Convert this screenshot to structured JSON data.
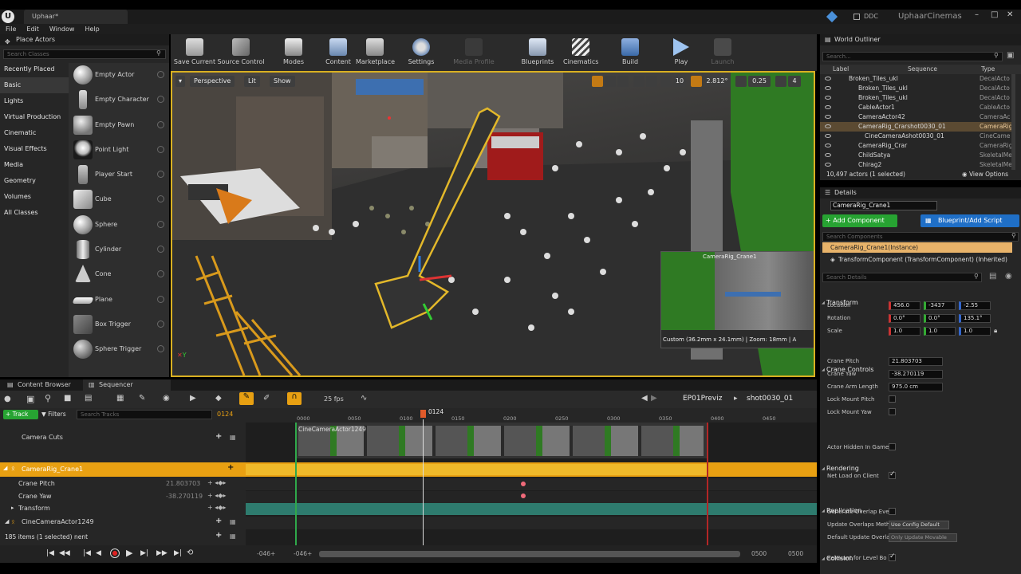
{
  "window": {
    "tab_title": "Uphaar*",
    "project_name": "UphaarCinemas",
    "ddc_label": "DDC"
  },
  "menu": [
    "File",
    "Edit",
    "Window",
    "Help"
  ],
  "place_actors": {
    "title": "Place Actors",
    "search_placeholder": "Search Classes",
    "categories": [
      "Recently Placed",
      "Basic",
      "Lights",
      "Virtual Production",
      "Cinematic",
      "Visual Effects",
      "Media",
      "Geometry",
      "Volumes",
      "All Classes"
    ],
    "selected_category": "Basic",
    "actors": [
      "Empty Actor",
      "Empty Character",
      "Empty Pawn",
      "Point Light",
      "Player Start",
      "Cube",
      "Sphere",
      "Cylinder",
      "Cone",
      "Plane",
      "Box Trigger",
      "Sphere Trigger"
    ]
  },
  "toolbar": {
    "buttons": [
      {
        "label": "Save Current",
        "icon": "save-icon",
        "enabled": true
      },
      {
        "label": "Source Control",
        "icon": "source-control-icon",
        "enabled": true
      },
      {
        "label": "Modes",
        "icon": "modes-icon",
        "enabled": true
      },
      {
        "label": "Content",
        "icon": "content-icon",
        "enabled": true
      },
      {
        "label": "Marketplace",
        "icon": "marketplace-icon",
        "enabled": true
      },
      {
        "label": "Settings",
        "icon": "settings-icon",
        "enabled": true
      },
      {
        "label": "Media Profile",
        "icon": "media-profile-icon",
        "enabled": false
      },
      {
        "label": "Blueprints",
        "icon": "blueprints-icon",
        "enabled": true
      },
      {
        "label": "Cinematics",
        "icon": "cinematics-icon",
        "enabled": true
      },
      {
        "label": "Build",
        "icon": "build-icon",
        "enabled": true
      },
      {
        "label": "Play",
        "icon": "play-icon",
        "enabled": true
      },
      {
        "label": "Launch",
        "icon": "launch-icon",
        "enabled": false
      }
    ]
  },
  "viewport": {
    "perspective": "Perspective",
    "lit": "Lit",
    "show": "Show",
    "grid_snap": "10",
    "rotation_snap": "2.812°",
    "scale_snap": "0.25",
    "camera_speed": "4",
    "pip_title": "CameraRig_Crane1",
    "pip_info": "Custom (36.2mm x 24.1mm) | Zoom: 18mm | A"
  },
  "bottom_tabs": [
    "Content Browser",
    "Sequencer"
  ],
  "sequencer": {
    "fps": "25 fps",
    "add_track": "+ Track",
    "filters": "Filters",
    "search_placeholder": "Search Tracks",
    "current_frame": "0124",
    "breadcrumb_sequence": "EP01Previz",
    "breadcrumb_shot": "shot0030_01",
    "ruler_ticks": [
      "0000",
      "0050",
      "0100",
      "0150",
      "0200",
      "0250",
      "0300",
      "0350",
      "0400",
      "0450"
    ],
    "playhead_label": "0124",
    "camera_cuts_clip": "CineCameraActor1249",
    "tracks": [
      {
        "name": "Camera Cuts",
        "value": ""
      },
      {
        "name": "CameraRig_Crane1",
        "value": ""
      },
      {
        "name": "Crane Pitch",
        "value": "21.803703"
      },
      {
        "name": "Crane Yaw",
        "value": "-38.270119"
      },
      {
        "name": "Transform",
        "value": ""
      },
      {
        "name": "CineCameraActor1249",
        "value": ""
      }
    ],
    "status": "185 items (1 selected)",
    "status_suffix": "nent",
    "range_start_a": "-046+",
    "range_start_b": "-046+",
    "range_end_a": "0500",
    "range_end_b": "0500"
  },
  "world_outliner": {
    "title": "World Outliner",
    "search_placeholder": "Search...",
    "columns": [
      "Label",
      "Sequence",
      "Type"
    ],
    "rows": [
      {
        "label": "Broken_Tiles_ukl",
        "type": "DecalActo"
      },
      {
        "label": "Broken_Tiles_ukl",
        "type": "DecalActo"
      },
      {
        "label": "Broken_Tiles_ukl",
        "type": "DecalActo"
      },
      {
        "label": "CableActor1",
        "type": "CableActo"
      },
      {
        "label": "CameraActor42",
        "type": "CameraAc"
      },
      {
        "label": "CameraRig_Crarshot0030_01",
        "type": "CameraRig",
        "selected": true
      },
      {
        "label": "CineCameraAshot0030_01",
        "type": "CineCame"
      },
      {
        "label": "CameraRig_Crar",
        "type": "CameraRig"
      },
      {
        "label": "ChildSatya",
        "type": "SkeletalMe"
      },
      {
        "label": "Chirag2",
        "type": "SkeletalMe"
      }
    ],
    "footer": "10,497 actors (1 selected)",
    "view_options": "View Options"
  },
  "details": {
    "title": "Details",
    "actor_name": "CameraRig_Crane1",
    "add_component": "+ Add Component",
    "blueprint_script": "Blueprint/Add Script",
    "search_components": "Search Components",
    "instance_row": "CameraRig_Crane1(Instance)",
    "transform_component": "TransformComponent (TransformComponent) (Inherited)",
    "search_details": "Search Details",
    "transform": {
      "header": "Transform",
      "location_label": "Location",
      "location": [
        "456.0",
        "-3437",
        "-2.55"
      ],
      "rotation_label": "Rotation",
      "rotation": [
        "0.0°",
        "0.0°",
        "135.1°"
      ],
      "scale_label": "Scale",
      "scale": [
        "1.0",
        "1.0",
        "1.0"
      ]
    },
    "crane_controls": {
      "header": "Crane Controls",
      "pitch_label": "Crane Pitch",
      "pitch": "21.803703",
      "yaw_label": "Crane Yaw",
      "yaw": "-38.270119",
      "arm_label": "Crane Arm Length",
      "arm": "975.0 cm",
      "lock_pitch_label": "Lock Mount Pitch",
      "lock_yaw_label": "Lock Mount Yaw"
    },
    "rendering": {
      "header": "Rendering",
      "hidden_label": "Actor Hidden In Game"
    },
    "replication": {
      "header": "Replication",
      "net_load_label": "Net Load on Client"
    },
    "collision": {
      "header": "Collision",
      "overlap_label": "Generate Overlap Ever",
      "update_overlaps_label": "Update Overlaps Meth",
      "update_overlaps_value": "Use Config Default",
      "default_update_label": "Default Update Overla",
      "default_update_value": "Only Update Movable",
      "relevant_label": "Relevant for Level Bo"
    }
  },
  "colors": {
    "accent_orange": "#e8a012",
    "selection_gold": "#d9b021",
    "add_green": "#27a332",
    "blueprint_blue": "#1f6fc7"
  }
}
